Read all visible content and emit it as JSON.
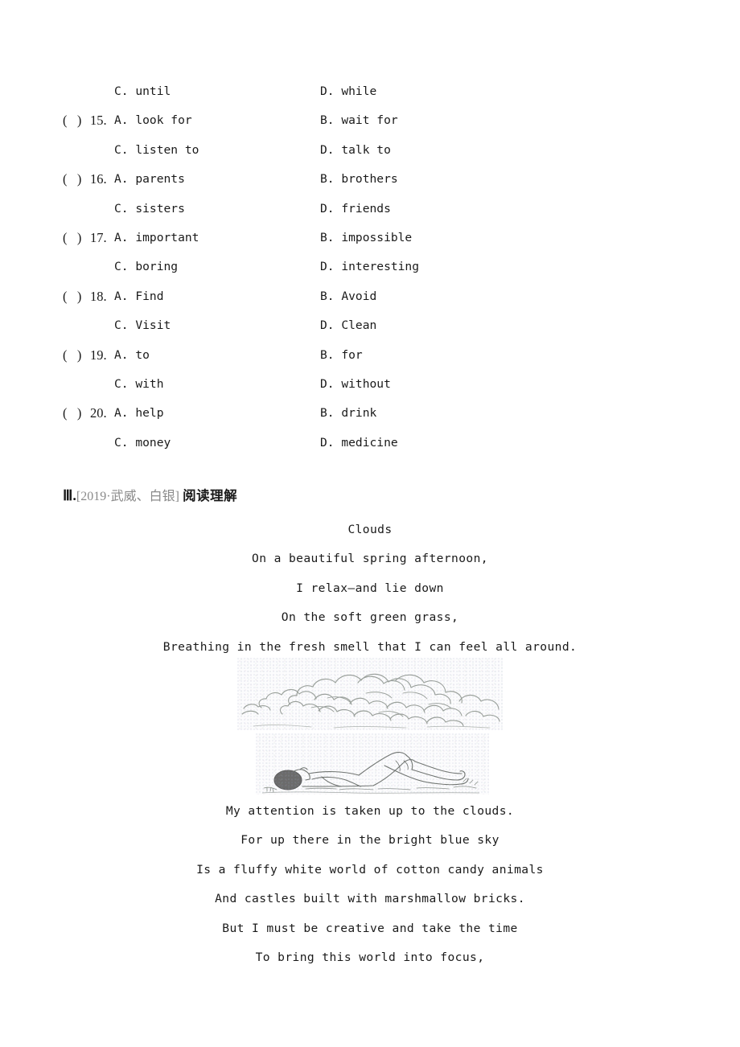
{
  "document": {
    "page_background": "#ffffff",
    "text_color": "#1a1a1a",
    "source_color": "#8a8a8a"
  },
  "multiple_choice": {
    "rows": [
      {
        "paren": "",
        "num": "",
        "left": "C. until",
        "right": "D. while"
      },
      {
        "paren": "(   )",
        "num": "15.",
        "left": "A. look for",
        "right": "B. wait for"
      },
      {
        "paren": "",
        "num": "",
        "left": "C. listen to",
        "right": "D. talk to"
      },
      {
        "paren": "(   )",
        "num": "16.",
        "left": "A. parents",
        "right": "B. brothers"
      },
      {
        "paren": "",
        "num": "",
        "left": "C. sisters",
        "right": "D. friends"
      },
      {
        "paren": "(   )",
        "num": "17.",
        "left": "A. important",
        "right": "B. impossible"
      },
      {
        "paren": "",
        "num": "",
        "left": "C. boring",
        "right": "D. interesting"
      },
      {
        "paren": "(   )",
        "num": "18.",
        "left": "A. Find",
        "right": "B. Avoid"
      },
      {
        "paren": "",
        "num": "",
        "left": "C. Visit",
        "right": "D. Clean"
      },
      {
        "paren": "(   )",
        "num": "19.",
        "left": "A. to",
        "right": "B. for"
      },
      {
        "paren": "",
        "num": "",
        "left": "C. with",
        "right": "D. without"
      },
      {
        "paren": "(   )",
        "num": "20.",
        "left": "A. help",
        "right": "B. drink"
      },
      {
        "paren": "",
        "num": "",
        "left": "C. money",
        "right": "D. medicine"
      }
    ]
  },
  "section": {
    "roman_numeral": "Ⅲ.",
    "source": "[2019·武威、白银]",
    "topic": "阅读理解"
  },
  "poem": {
    "title": "Clouds",
    "stanza_one": [
      "On a beautiful spring afternoon,",
      "I relax—and lie down",
      "On the soft green grass,",
      "Breathing in the fresh smell that I can feel all around."
    ],
    "stanza_two": [
      "My attention is taken up to the clouds.",
      "For up there in the bright blue sky",
      "Is a fluffy white world of cotton candy animals",
      "And castles built with marshmallow bricks.",
      "But I must be creative and take the time",
      "To bring this world into focus,"
    ]
  },
  "illustrations": [
    {
      "name": "clouds-illustration",
      "caption": ""
    },
    {
      "name": "person-lying-on-grass-illustration",
      "caption": ""
    }
  ]
}
